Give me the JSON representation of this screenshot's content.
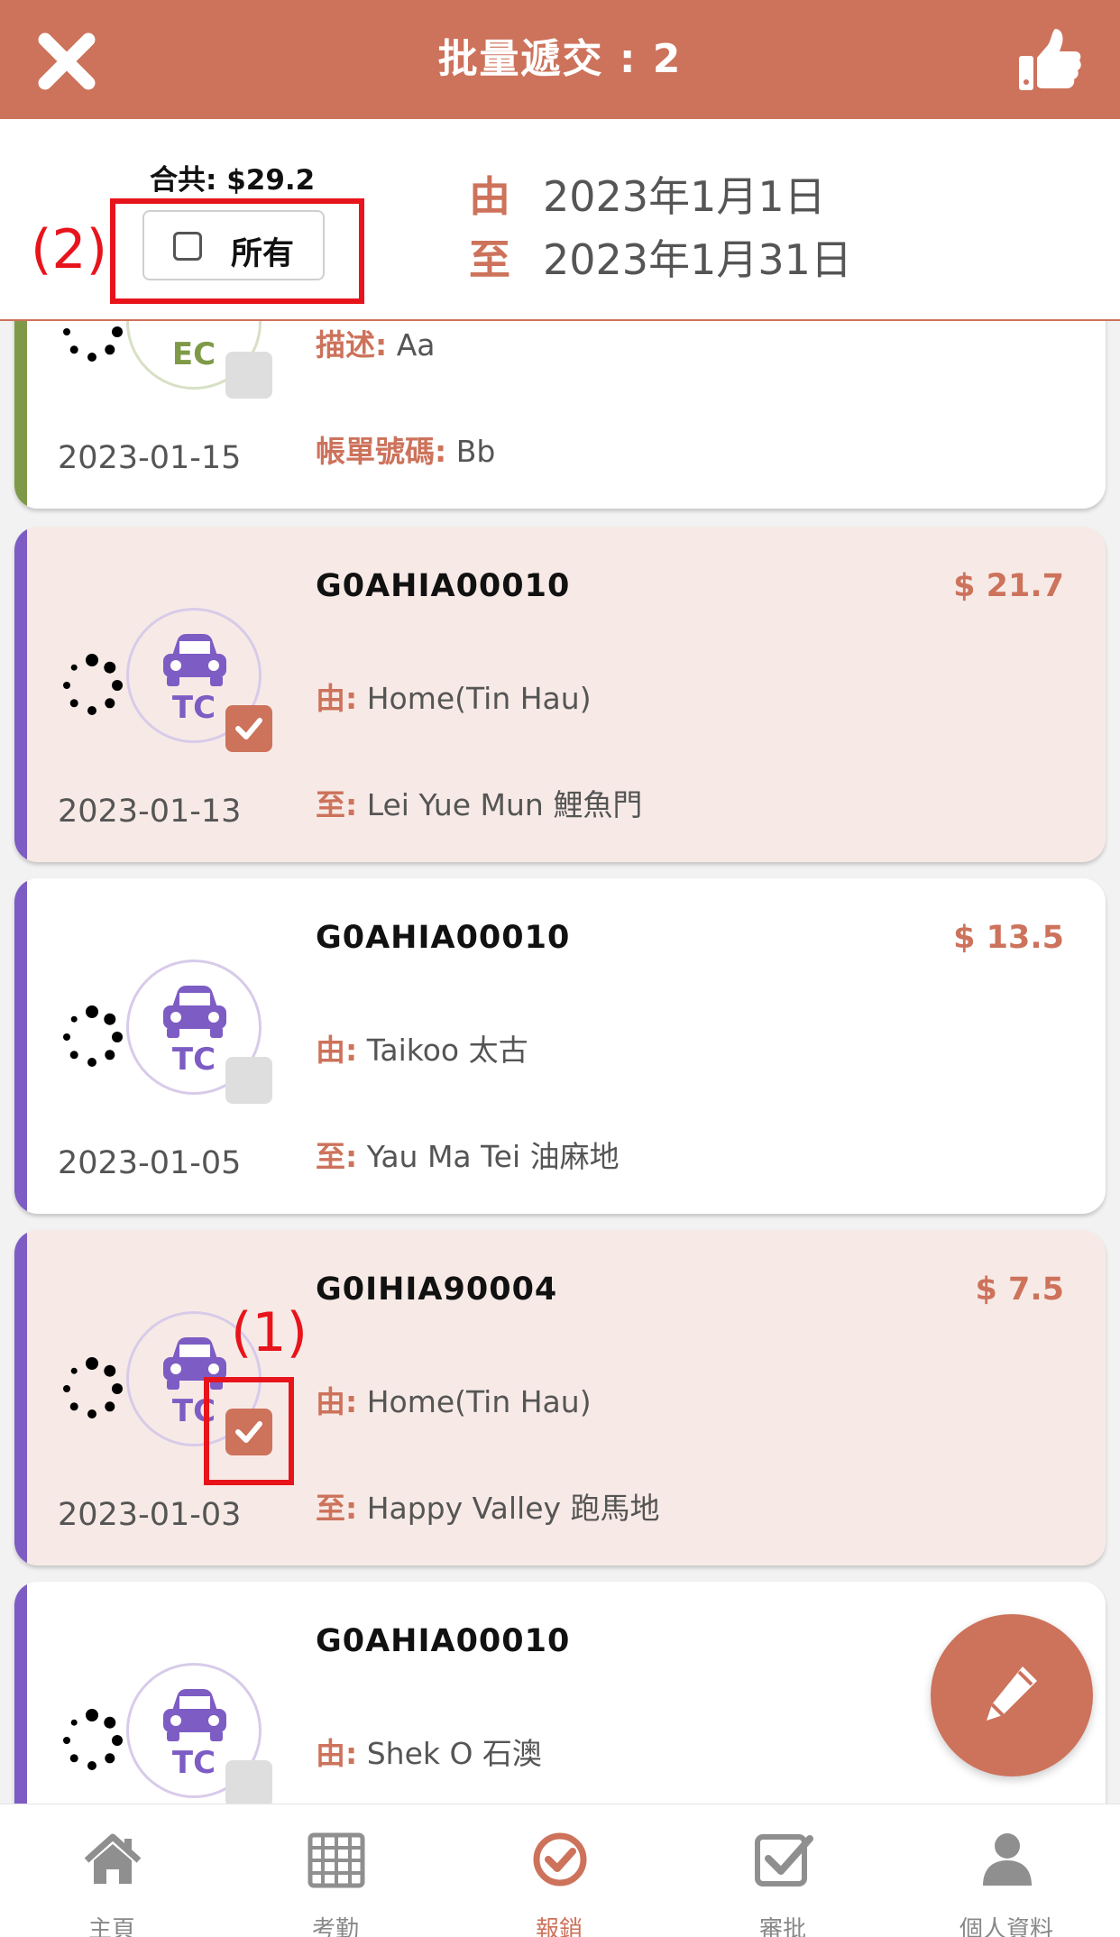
{
  "header": {
    "title": "批量遞交 : 2",
    "close_icon": "close-icon",
    "confirm_icon": "thumbs-up-icon",
    "color": "#cd725b"
  },
  "summary": {
    "total": "合共: $29.2",
    "select_all_label": "所有",
    "select_all_checked": false,
    "from_key": "由",
    "from_date": "2023年1月1日",
    "to_key": "至",
    "to_date": "2023年1月31日"
  },
  "annotations": {
    "label_1": "(1)",
    "label_2": "(2)",
    "color": "#e8141c"
  },
  "claims": [
    {
      "type": "EC",
      "date": "2023-01-15",
      "code": "",
      "amount": "",
      "line1_key": "描述:",
      "line1_value": "Aa",
      "line2_key": "帳單號碼:",
      "line2_value": "Bb",
      "checked": false
    },
    {
      "type": "TC",
      "date": "2023-01-13",
      "code": "G0AHIA00010",
      "amount": "$ 21.7",
      "line1_key": "由:",
      "line1_value": "Home(Tin Hau)",
      "line2_key": "至:",
      "line2_value": "Lei Yue Mun 鯉魚門",
      "checked": true
    },
    {
      "type": "TC",
      "date": "2023-01-05",
      "code": "G0AHIA00010",
      "amount": "$ 13.5",
      "line1_key": "由:",
      "line1_value": "Taikoo 太古",
      "line2_key": "至:",
      "line2_value": "Yau Ma Tei 油麻地",
      "checked": false
    },
    {
      "type": "TC",
      "date": "2023-01-03",
      "code": "G0IHIA90004",
      "amount": "$ 7.5",
      "line1_key": "由:",
      "line1_value": "Home(Tin Hau)",
      "line2_key": "至:",
      "line2_value": "Happy Valley 跑馬地",
      "checked": true
    },
    {
      "type": "TC",
      "date": "",
      "code": "G0AHIA00010",
      "amount": "",
      "line1_key": "由:",
      "line1_value": "Shek O 石澳",
      "line2_key": "",
      "line2_value": "",
      "checked": false
    }
  ],
  "fab": {
    "icon": "pencil-icon"
  },
  "tabs": [
    {
      "label": "主頁",
      "icon": "home-icon",
      "active": false
    },
    {
      "label": "考勤",
      "icon": "calendar-grid-icon",
      "active": false
    },
    {
      "label": "報銷",
      "icon": "check-circle-icon",
      "active": true
    },
    {
      "label": "審批",
      "icon": "checkbox-icon",
      "active": false
    },
    {
      "label": "個人資料",
      "icon": "user-icon",
      "active": false
    }
  ]
}
